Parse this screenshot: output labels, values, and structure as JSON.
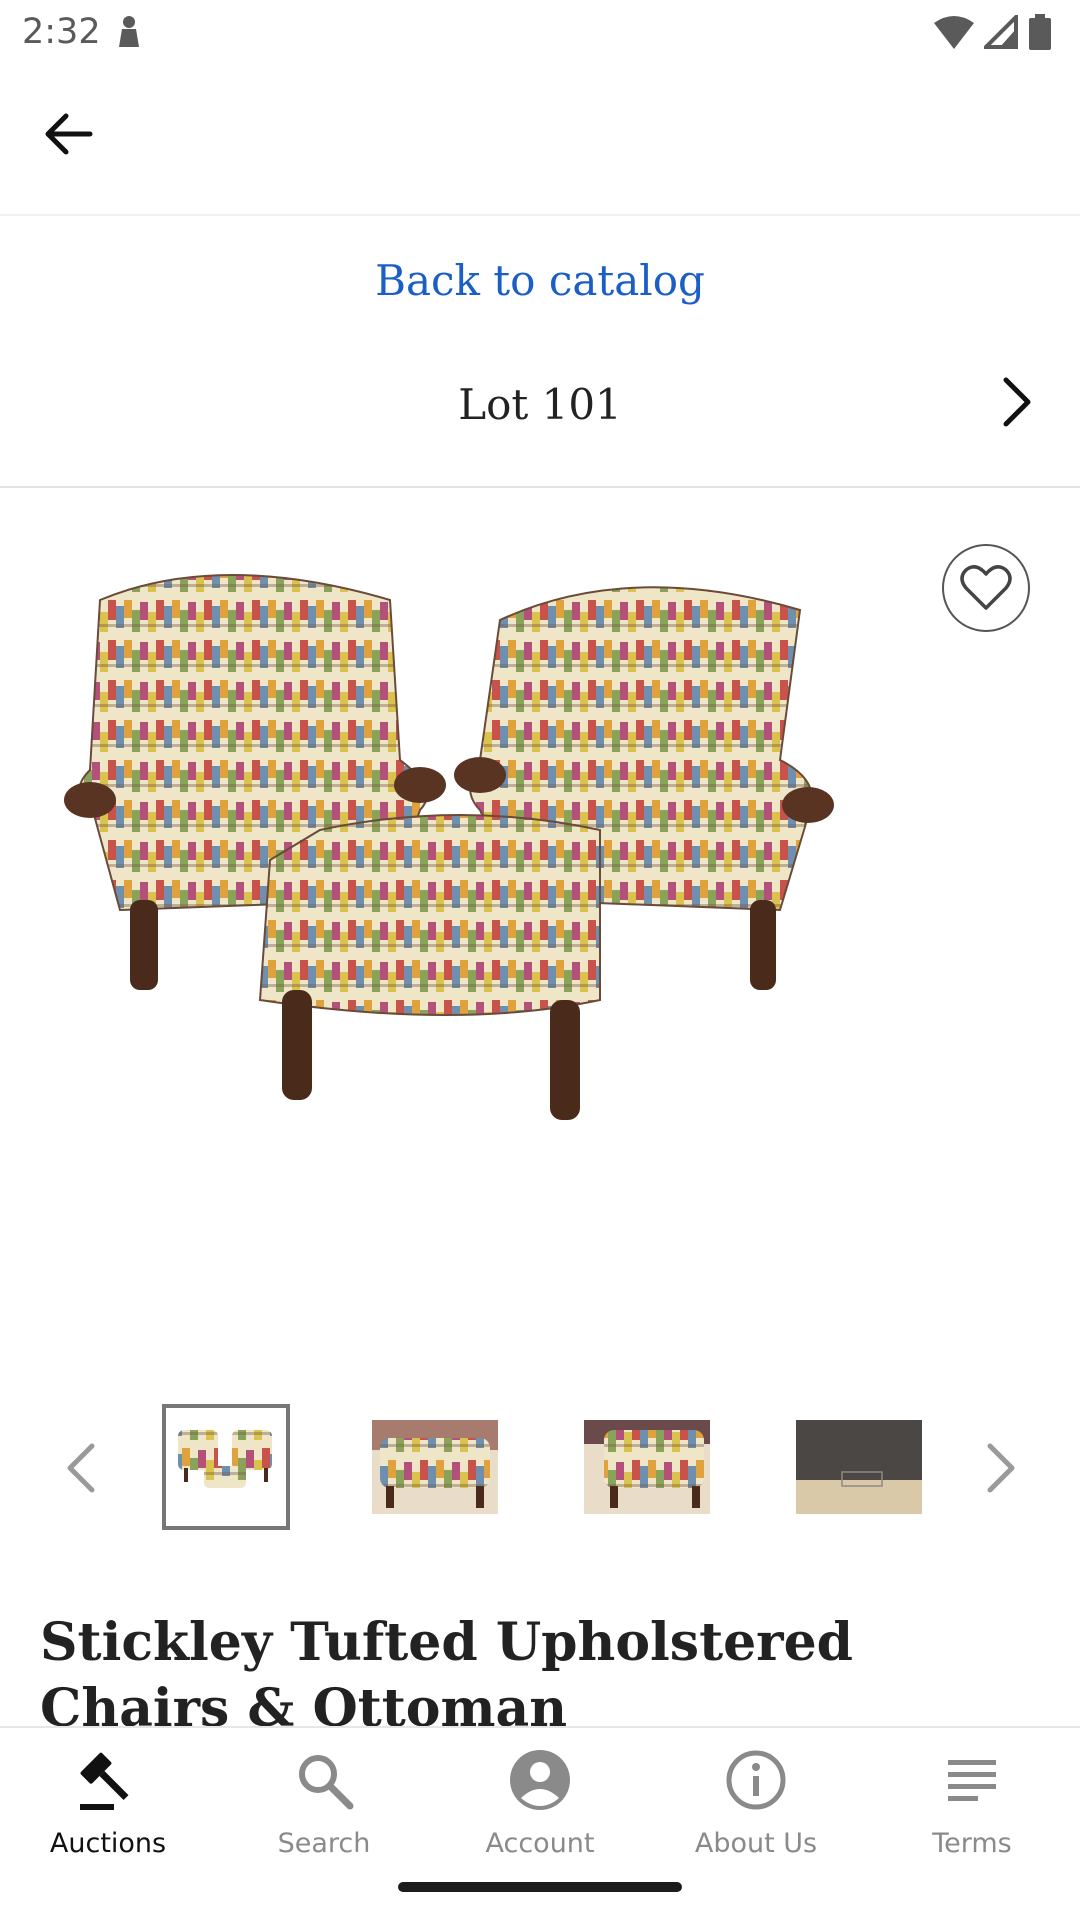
{
  "status_bar": {
    "time": "2:32"
  },
  "header": {
    "back_to_catalog": "Back to catalog",
    "lot_title": "Lot 101"
  },
  "lot": {
    "name": "Stickley Tufted Upholstered Chairs & Ottoman"
  },
  "gallery": {
    "thumbnail_count": 4,
    "selected_index": 0
  },
  "bottom_nav": {
    "items": [
      {
        "label": "Auctions",
        "icon": "gavel-icon",
        "active": true
      },
      {
        "label": "Search",
        "icon": "search-icon",
        "active": false
      },
      {
        "label": "Account",
        "icon": "account-icon",
        "active": false
      },
      {
        "label": "About Us",
        "icon": "info-icon",
        "active": false
      },
      {
        "label": "Terms",
        "icon": "terms-icon",
        "active": false
      }
    ]
  },
  "colors": {
    "link": "#1b5fc6",
    "active_nav": "#111111",
    "inactive_nav": "#8a8a8a"
  }
}
